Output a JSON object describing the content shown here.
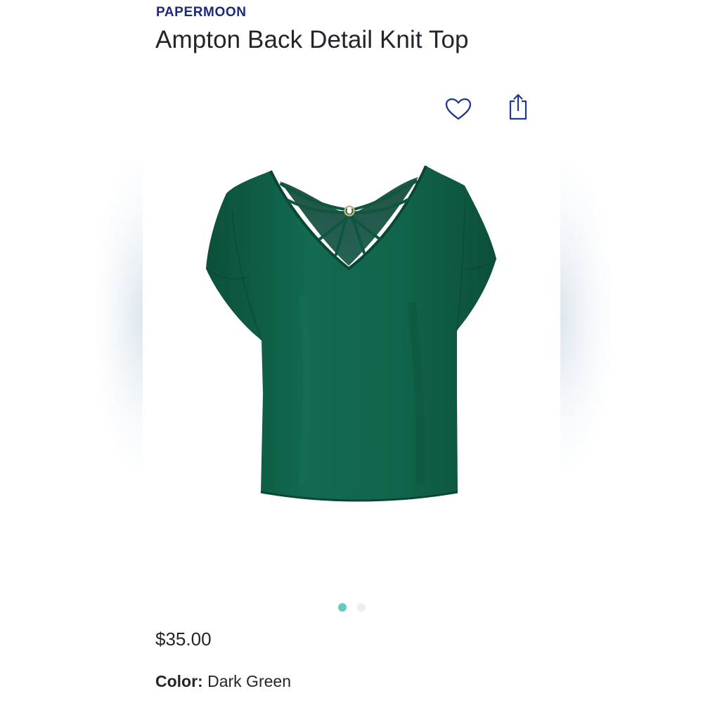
{
  "product": {
    "brand": "PAPERMOON",
    "title": "Ampton Back Detail Knit Top",
    "price": "$35.00",
    "color_label": "Color:",
    "color_value": "Dark Green"
  },
  "actions": {
    "favorite_icon": "heart-outline-icon",
    "share_icon": "share-icon"
  },
  "gallery": {
    "image_subject": "green-knit-top",
    "garment_color": "#0f5c45",
    "slide_count": 2,
    "active_slide": 1
  },
  "colors": {
    "brand_text": "#1e2a78",
    "accent_dot": "#5fcdbd",
    "inactive_dot": "#eceeef",
    "icon_stroke": "#1e3a8a"
  }
}
